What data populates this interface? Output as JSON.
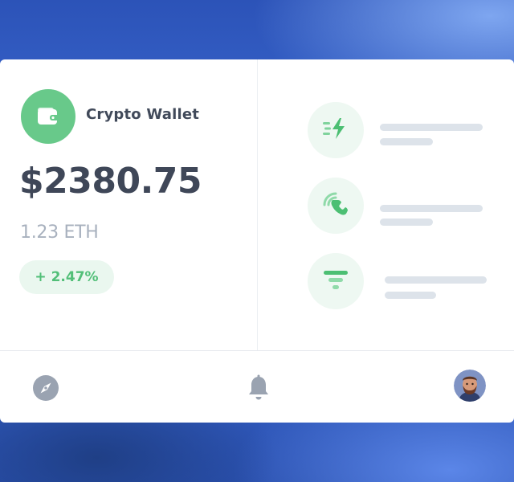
{
  "wallet": {
    "icon": "wallet-icon",
    "title": "Crypto Wallet",
    "balance": "$2380.75",
    "eth_amount": "1.23 ETH",
    "change": "+ 2.47%",
    "accent_color": "#68c98a",
    "change_color": "#52bf78"
  },
  "features": [
    {
      "icon": "lightning-icon"
    },
    {
      "icon": "phone-icon"
    },
    {
      "icon": "filter-icon"
    }
  ],
  "bottom_nav": [
    {
      "icon": "compass-icon"
    },
    {
      "icon": "bell-icon"
    },
    {
      "icon": "avatar"
    }
  ]
}
